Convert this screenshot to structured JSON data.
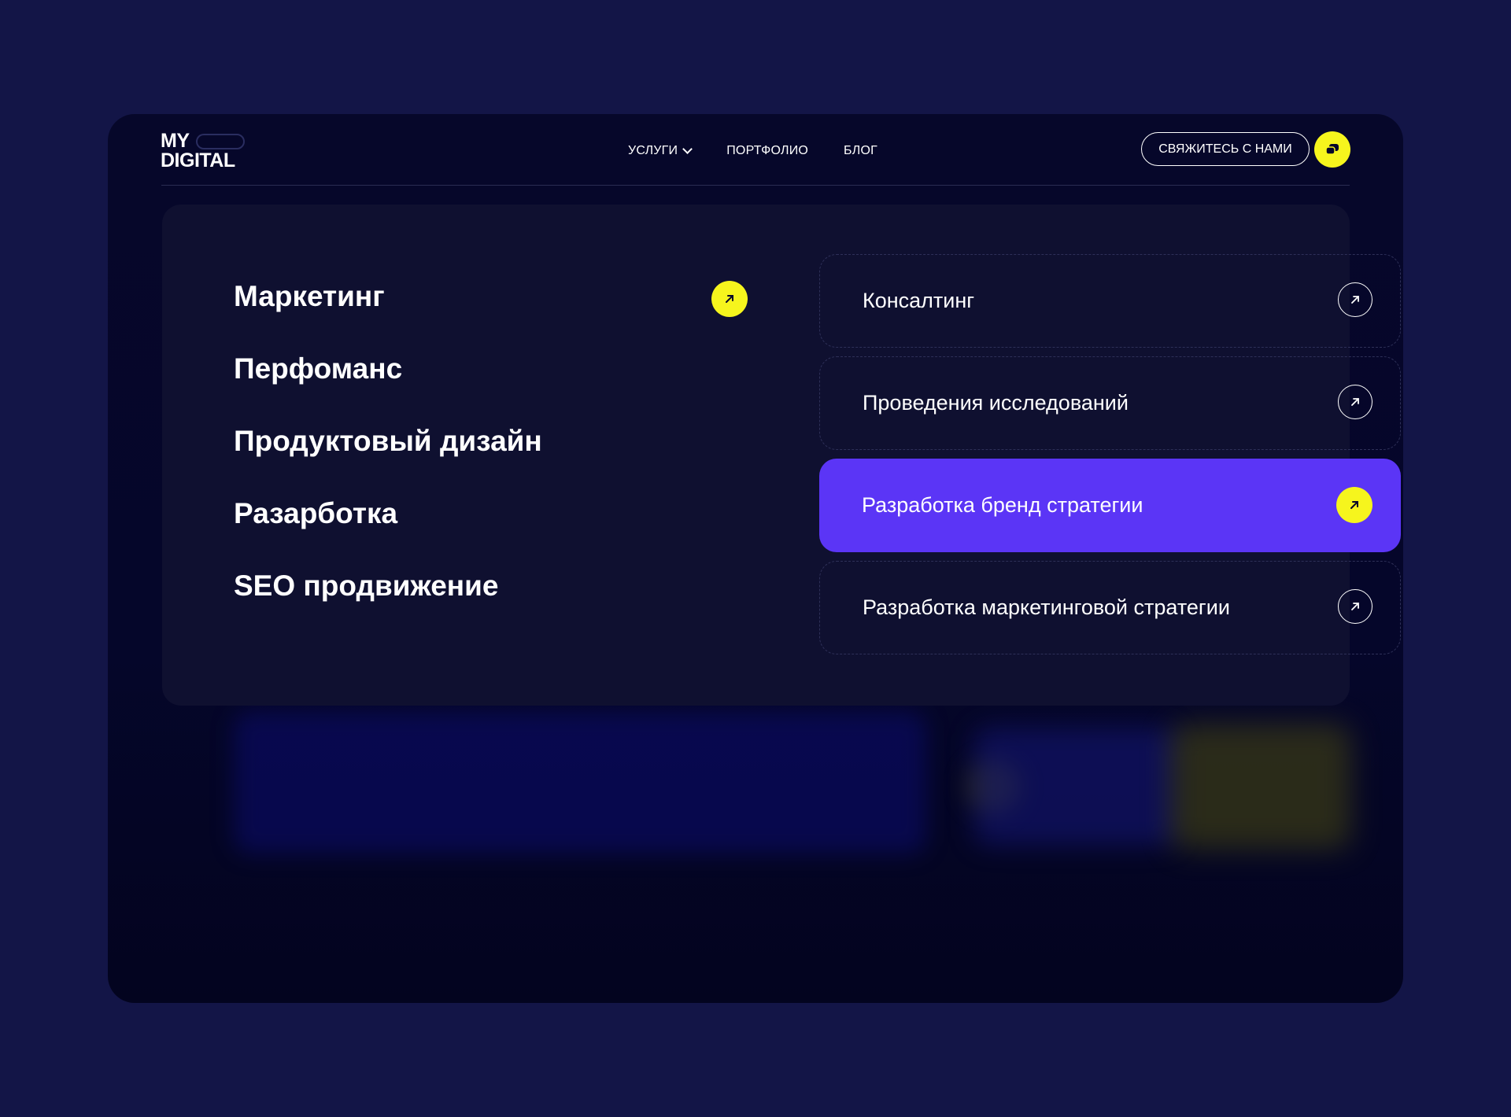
{
  "logo": {
    "line1": "MY",
    "line2": "DIGITAL"
  },
  "nav": {
    "services": "УСЛУГИ",
    "portfolio": "ПОРТФОЛИО",
    "blog": "БЛОГ"
  },
  "contact_label": "СВЯЖИТЕСЬ С НАМИ",
  "categories": [
    "Маркетинг",
    "Перфоманс",
    "Продуктовый дизайн",
    "Разарботка",
    "SEO продвижение"
  ],
  "services": [
    "Консалтинг",
    "Проведения исследований",
    "Разработка бренд стратегии",
    "Разработка маркетинговой стратегии"
  ],
  "colors": {
    "page_bg": "#131547",
    "frame_bg": "#06072a",
    "panel_bg": "#0f1030",
    "accent_yellow": "#f6f51d",
    "accent_purple": "#5b35f6"
  }
}
